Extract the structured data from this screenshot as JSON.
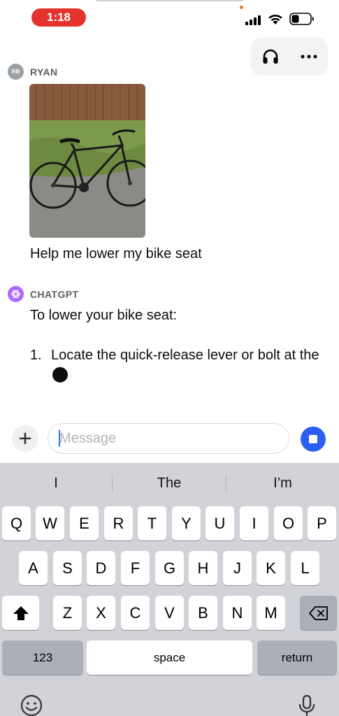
{
  "status_bar": {
    "time": "1:18",
    "icons": [
      "signal-icon",
      "wifi-icon",
      "battery-icon"
    ]
  },
  "header": {
    "buttons": [
      "headphones-icon",
      "more-options-icon"
    ]
  },
  "conversation": {
    "user": {
      "initials": "RB",
      "name": "RYAN",
      "image": "bike-photo",
      "message": "Help me lower my bike seat"
    },
    "assistant": {
      "name": "CHATGPT",
      "intro": "To lower your bike seat:",
      "steps": [
        {
          "number": "1.",
          "text": "Locate the quick-release lever or bolt at the"
        }
      ]
    }
  },
  "composer": {
    "placeholder": "Message",
    "add_icon": "plus-icon",
    "stop_icon": "stop-icon"
  },
  "keyboard": {
    "suggestions": [
      "I",
      "The",
      "I’m"
    ],
    "row1": [
      "Q",
      "W",
      "E",
      "R",
      "T",
      "Y",
      "U",
      "I",
      "O",
      "P"
    ],
    "row2": [
      "A",
      "S",
      "D",
      "F",
      "G",
      "H",
      "J",
      "K",
      "L"
    ],
    "row3": [
      "Z",
      "X",
      "C",
      "V",
      "B",
      "N",
      "M"
    ],
    "numbers_key": "123",
    "space_key": "space",
    "return_key": "return"
  },
  "colors": {
    "time_pill": "#e5322d",
    "accent": "#2a5ef5",
    "assistant_avatar": "#ab68ff",
    "keyboard_bg": "#d1d3d9"
  }
}
